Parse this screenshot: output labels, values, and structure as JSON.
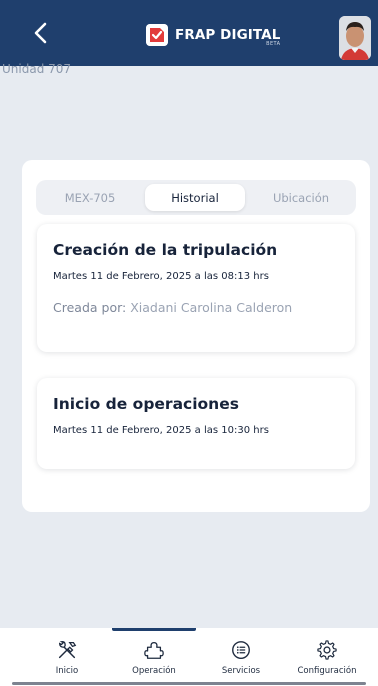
{
  "header": {
    "app_name": "FRAP DIGITAL",
    "badge": "BETA"
  },
  "background": {
    "peek_text": "Unidad 707"
  },
  "tabs": [
    {
      "label": "MEX-705"
    },
    {
      "label": "Historial",
      "selected": true
    },
    {
      "label": "Ubicación"
    }
  ],
  "history": [
    {
      "title": "Creación de la tripulación",
      "date": "Martes 11 de Febrero, 2025 a las 08:13 hrs",
      "created_by_label": "Creada por:",
      "created_by": "Xiadani Carolina Calderon"
    },
    {
      "title": "Inicio de operaciones",
      "date": "Martes 11 de Febrero, 2025 a las 10:30 hrs"
    }
  ],
  "nav": {
    "active": "Operación",
    "items": [
      {
        "label": "Inicio",
        "icon": "tools-icon"
      },
      {
        "label": "Operación",
        "icon": "puzzle-icon"
      },
      {
        "label": "Servicios",
        "icon": "list-icon"
      },
      {
        "label": "Configuración",
        "icon": "gear-icon"
      }
    ]
  },
  "colors": {
    "header": "#1f3f6d",
    "background": "#e7ebf1",
    "logo_red": "#e23b3b"
  }
}
